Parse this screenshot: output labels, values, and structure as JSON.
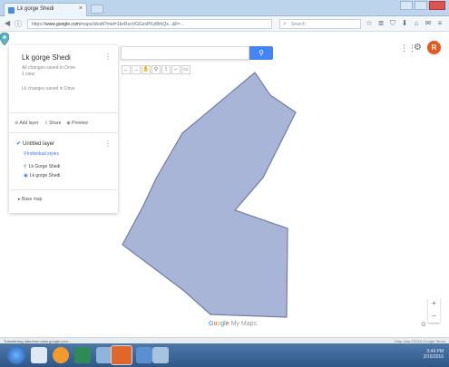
{
  "browser": {
    "tab_title": "Lk gorge Shedi",
    "close_glyph": "×",
    "url_prefix": "https://",
    "url_domain": "www.google.com",
    "url_path": "/maps/d/edit?mid=1bxRsoVGGzsPKz8frkQx...&ll=...",
    "search_placeholder": "Search",
    "toolbar_icons": [
      "star-icon",
      "list-icon",
      "shield-icon",
      "download-icon",
      "home-icon",
      "chat-icon",
      "menu-icon"
    ]
  },
  "map_panel": {
    "title": "Lk gorge Shedi",
    "meta1": "All changes saved in Drive",
    "meta2": "1 view",
    "description": "Lk changes saved in Drive",
    "actions": [
      "Add layer",
      "Share",
      "Preview"
    ],
    "layer_title": "Untitled layer",
    "layer_link": "Individual styles",
    "layer_items": [
      "Lk Gorge Shedi",
      "Lk gorge Shedi"
    ],
    "base_map": "Base map"
  },
  "map": {
    "search_value": "",
    "search_button_glyph": "⚲",
    "toolbar": [
      "←",
      "→",
      "✋",
      "⚲",
      "⌇",
      "⌐",
      "▭"
    ],
    "avatar_initial": "R",
    "logo": [
      "G",
      "o",
      "o",
      "g",
      "l",
      "e"
    ],
    "logo_suffix": "My Maps",
    "zoom_in": "+",
    "zoom_out": "−",
    "polygon_fill": "#a9b5d6",
    "polygon_stroke": "#6f7ea8",
    "marker_color": "#5fb1c4"
  },
  "statusbar": {
    "left": "Transferring data from www.google.com...",
    "right": "Map data ©2016 Google  Terms"
  },
  "taskbar": {
    "clock_time": "3:44 PM",
    "clock_date": "3/16/2016"
  }
}
